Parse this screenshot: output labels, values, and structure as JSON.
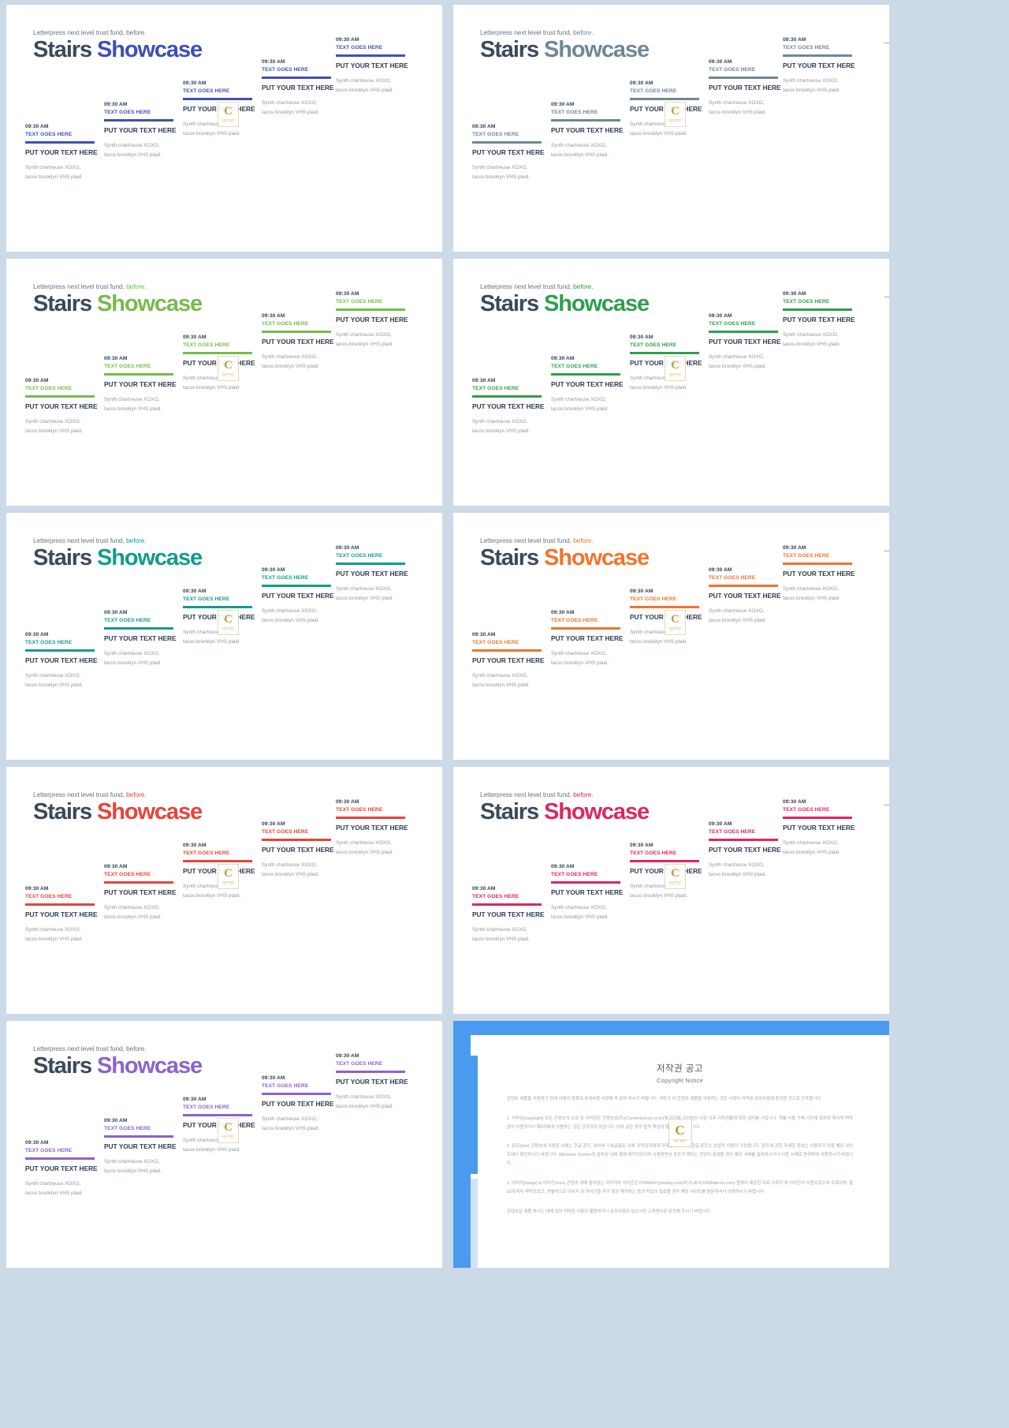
{
  "deck": {
    "eyebrow_prefix": "Letterpress next level trust fund,",
    "eyebrow_highlight": "before.",
    "title_first": "Stairs",
    "title_second": "Showcase",
    "step": {
      "time": "09:30 AM",
      "sub": "TEXT GOES HERE",
      "head": "PUT YOUR TEXT HERE",
      "body_line1": "Synth chartreuse XOXO,",
      "body_line2": "tacos brooklyn VHS plaid."
    },
    "watermark": {
      "letter": "C",
      "caption": "CONTENTS",
      "caption2": "MALL.COM"
    },
    "slides": [
      {
        "name": "slide-indigo",
        "accent": "#3f4fb8",
        "eyebrow_accent": false
      },
      {
        "name": "slide-slate",
        "accent": "#6f8797",
        "eyebrow_accent": true
      },
      {
        "name": "slide-lime",
        "accent": "#76bb4b",
        "eyebrow_accent": true
      },
      {
        "name": "slide-green",
        "accent": "#2f9e4f",
        "eyebrow_accent": true
      },
      {
        "name": "slide-teal",
        "accent": "#149b8e",
        "eyebrow_accent": true
      },
      {
        "name": "slide-orange",
        "accent": "#f2742c",
        "eyebrow_accent": true
      },
      {
        "name": "slide-red",
        "accent": "#e8433a",
        "eyebrow_accent": true
      },
      {
        "name": "slide-crimson",
        "accent": "#e0265f",
        "eyebrow_accent": true
      },
      {
        "name": "slide-purple",
        "accent": "#8a63c9",
        "eyebrow_accent": false
      }
    ]
  },
  "copyright": {
    "title_ko": "저작권 공고",
    "title_en": "Copyright Notice",
    "intro": "콘텐츠 제품을 사용하기 전에 아래의 항목과 유의사항 사항에 꼭 읽어 주시기 바랍니다. 귀하가 이 콘텐츠 제품을 사용하는 것은 사항이 저작권 유의사항에 동의한 것으로 간주합니다.",
    "p1": "1. 저작권(copyright) 모든 콘텐츠의 소유 및 저작권은 콘텐츠샵(주)(Contentsshop.co.kr)에 있으며 구입하신 시점 이후 저작권물에 대한 권리를 가집니다. 개별 사용 구매 기간에 회사의 명시적 허락없이 이용하거나 제3자에게 이용하는 것은 금지되어 있습니다. 이와 같은 경우 법적 책임이 발생할 수 있습니다.",
    "p2": "2. 폰트(font) 콘텐츠에 사용된 서체는 한글 폰트, 네이버 나눔글꼴로 서체 저작권자에게 저작권이 있으며 한글 폰트는 상업적 사용이 가능합니다. 폰트에 관한 자세한 정보는 사용자가 직접 해당 사이트에서 확인하시기 바랍니다. Windows System의 설치된 서체 중에 제작되었으며 사용하면서 폰트가 깨지는 현상이 발생할 경우 해당 서체를 설치하시거나 다른 서체로 변경하여 사용하시기 바랍니다.",
    "p3": "3. 이미지(image) & 아이콘(icon) 콘텐츠 내에 들어있는 이미지와 아이콘은 PIXABAY(pixabay.com)와 FLATICON(flaticon.com) 등에서 제공한 무료 이미지 및 아이콘이 사용되었으며 무료이며, 필요에 따라 제작되었고, 개별적으로 이미지 및 아이콘을 추가 혹은 제거하는 등의 작업이 필요할 경우 해당 사이트를 방문하셔서 이용하시기 바랍니다.",
    "footer": "콘텐츠샵 제품 하시는 데에 있어 어떠한 사항이 불편하거나 문의사항이 있으시면 고객센터로 문의해 주시기 바랍니다."
  }
}
